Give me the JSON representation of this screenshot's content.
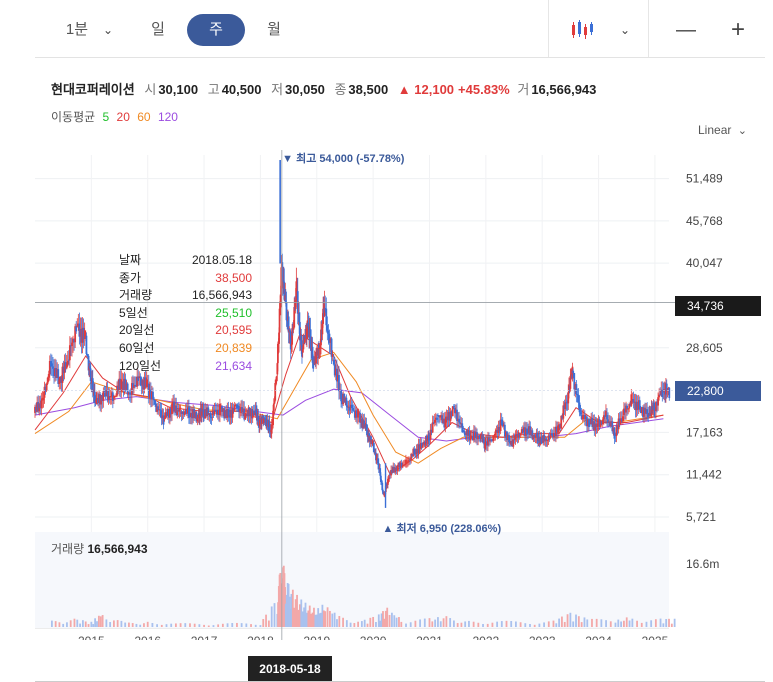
{
  "toolbar": {
    "periods": [
      "1분",
      "일",
      "주",
      "월"
    ],
    "active_period": "주",
    "chart_type_icon": "candle-chart-icon",
    "zoom_out": "—",
    "zoom_in": "+"
  },
  "stock": {
    "name": "현대코퍼레이션",
    "open_label": "시",
    "open": "30,100",
    "high_label": "고",
    "high": "40,500",
    "low_label": "저",
    "low": "30,050",
    "close_label": "종",
    "close": "38,500",
    "change": "▲ 12,100",
    "change_pct": "+45.83%",
    "volume_label": "거",
    "volume": "16,566,943"
  },
  "ma_legend": {
    "label": "이동평균",
    "periods": [
      "5",
      "20",
      "60",
      "120"
    ]
  },
  "scale": "Linear",
  "tooltip": {
    "rows": [
      {
        "k": "날짜",
        "v": "2018.05.18"
      },
      {
        "k": "종가",
        "v": "38,500"
      },
      {
        "k": "거래량",
        "v": "16,566,943"
      },
      {
        "k": "5일선",
        "v": "25,510"
      },
      {
        "k": "20일선",
        "v": "20,595"
      },
      {
        "k": "60일선",
        "v": "20,839"
      },
      {
        "k": "120일선",
        "v": "21,634"
      }
    ]
  },
  "volume_panel": {
    "label": "거래량",
    "value": "16,566,943",
    "tick": "16.6m"
  },
  "crosshair_date": "2018-05-18",
  "price_tags": {
    "crosshair": "34,736",
    "last": "22,800"
  },
  "chart_data": {
    "type": "line",
    "subtype": "candlestick",
    "x_ticks": [
      "2015",
      "2016",
      "2017",
      "2018",
      "2019",
      "2020",
      "2021",
      "2022",
      "2023",
      "2024",
      "2025"
    ],
    "y_ticks": [
      "51,489",
      "45,768",
      "40,047",
      "28,605",
      "17,163",
      "11,442",
      "5,721"
    ],
    "ylim": [
      5721,
      54000
    ],
    "xlim": [
      2014.0,
      2025.25
    ],
    "annotations": {
      "high": "▼ 최고 54,000 (-57.78%)",
      "low": "▲ 최저 6,950 (228.06%)"
    },
    "high_point": {
      "x": 2018.35,
      "y": 54000
    },
    "low_point": {
      "x": 2020.22,
      "y": 6950
    },
    "crosshair_x": 2018.38,
    "crosshair_y": 34736,
    "last_value": 22800,
    "colors": {
      "up": "#e03b3b",
      "down": "#3b6fd6",
      "ma5": "#1fbf2a",
      "ma20": "#e03b3b",
      "ma60": "#f08a24",
      "ma120": "#9b4ce0",
      "accent": "#3b5a9a"
    },
    "close": [
      [
        2014.0,
        19800
      ],
      [
        2014.15,
        21500
      ],
      [
        2014.3,
        26500
      ],
      [
        2014.45,
        24000
      ],
      [
        2014.6,
        27000
      ],
      [
        2014.75,
        31500
      ],
      [
        2014.9,
        30000
      ],
      [
        2015.0,
        24500
      ],
      [
        2015.1,
        21000
      ],
      [
        2015.25,
        22500
      ],
      [
        2015.4,
        21800
      ],
      [
        2015.55,
        24000
      ],
      [
        2015.7,
        22500
      ],
      [
        2015.85,
        24500
      ],
      [
        2016.0,
        23500
      ],
      [
        2016.15,
        21000
      ],
      [
        2016.3,
        19000
      ],
      [
        2016.45,
        20500
      ],
      [
        2016.6,
        20000
      ],
      [
        2016.75,
        19800
      ],
      [
        2016.9,
        19200
      ],
      [
        2017.0,
        20000
      ],
      [
        2017.15,
        19500
      ],
      [
        2017.3,
        20300
      ],
      [
        2017.45,
        19500
      ],
      [
        2017.6,
        20800
      ],
      [
        2017.75,
        19500
      ],
      [
        2017.9,
        20000
      ],
      [
        2018.0,
        18500
      ],
      [
        2018.1,
        19000
      ],
      [
        2018.2,
        17000
      ],
      [
        2018.3,
        25000
      ],
      [
        2018.38,
        38500
      ],
      [
        2018.45,
        35000
      ],
      [
        2018.55,
        29000
      ],
      [
        2018.65,
        36000
      ],
      [
        2018.75,
        28000
      ],
      [
        2018.85,
        32000
      ],
      [
        2018.95,
        26500
      ],
      [
        2019.05,
        28500
      ],
      [
        2019.15,
        34000
      ],
      [
        2019.3,
        27000
      ],
      [
        2019.45,
        22000
      ],
      [
        2019.6,
        20500
      ],
      [
        2019.75,
        19500
      ],
      [
        2019.9,
        17500
      ],
      [
        2020.0,
        15500
      ],
      [
        2020.1,
        13000
      ],
      [
        2020.2,
        8500
      ],
      [
        2020.3,
        11500
      ],
      [
        2020.45,
        12500
      ],
      [
        2020.6,
        13000
      ],
      [
        2020.75,
        14500
      ],
      [
        2020.9,
        15500
      ],
      [
        2021.0,
        16500
      ],
      [
        2021.15,
        19500
      ],
      [
        2021.3,
        18500
      ],
      [
        2021.45,
        20500
      ],
      [
        2021.6,
        17500
      ],
      [
        2021.75,
        16500
      ],
      [
        2021.9,
        16800
      ],
      [
        2022.0,
        15500
      ],
      [
        2022.15,
        16500
      ],
      [
        2022.3,
        18500
      ],
      [
        2022.45,
        15500
      ],
      [
        2022.6,
        17000
      ],
      [
        2022.75,
        17500
      ],
      [
        2022.9,
        16500
      ],
      [
        2023.0,
        16000
      ],
      [
        2023.15,
        16500
      ],
      [
        2023.3,
        17500
      ],
      [
        2023.45,
        21500
      ],
      [
        2023.55,
        25500
      ],
      [
        2023.7,
        19500
      ],
      [
        2023.85,
        18500
      ],
      [
        2024.0,
        18000
      ],
      [
        2024.15,
        19500
      ],
      [
        2024.3,
        17000
      ],
      [
        2024.45,
        19500
      ],
      [
        2024.6,
        21500
      ],
      [
        2024.75,
        20500
      ],
      [
        2024.9,
        19500
      ],
      [
        2025.0,
        20500
      ],
      [
        2025.15,
        22800
      ]
    ],
    "ma20": [
      [
        2014.0,
        17500
      ],
      [
        2014.5,
        22500
      ],
      [
        2014.9,
        27500
      ],
      [
        2015.2,
        24500
      ],
      [
        2015.6,
        22500
      ],
      [
        2016.0,
        22000
      ],
      [
        2016.4,
        20500
      ],
      [
        2017.0,
        20000
      ],
      [
        2017.6,
        20000
      ],
      [
        2018.2,
        18500
      ],
      [
        2018.45,
        25000
      ],
      [
        2018.7,
        30500
      ],
      [
        2019.0,
        29000
      ],
      [
        2019.3,
        27500
      ],
      [
        2019.6,
        22000
      ],
      [
        2020.0,
        16500
      ],
      [
        2020.3,
        11500
      ],
      [
        2020.7,
        13500
      ],
      [
        2021.0,
        15500
      ],
      [
        2021.4,
        18500
      ],
      [
        2021.8,
        17000
      ],
      [
        2022.3,
        16500
      ],
      [
        2022.8,
        17000
      ],
      [
        2023.3,
        17000
      ],
      [
        2023.6,
        20500
      ],
      [
        2024.0,
        18500
      ],
      [
        2024.5,
        18500
      ],
      [
        2025.15,
        19500
      ]
    ],
    "ma60": [
      [
        2014.0,
        17000
      ],
      [
        2014.6,
        20000
      ],
      [
        2015.0,
        24000
      ],
      [
        2015.6,
        22500
      ],
      [
        2016.2,
        21500
      ],
      [
        2017.0,
        20200
      ],
      [
        2017.8,
        20000
      ],
      [
        2018.3,
        19000
      ],
      [
        2018.6,
        23000
      ],
      [
        2018.9,
        27000
      ],
      [
        2019.3,
        28000
      ],
      [
        2019.7,
        24000
      ],
      [
        2020.0,
        19500
      ],
      [
        2020.4,
        14500
      ],
      [
        2020.8,
        13000
      ],
      [
        2021.2,
        15000
      ],
      [
        2021.6,
        16500
      ],
      [
        2022.2,
        16500
      ],
      [
        2022.8,
        16500
      ],
      [
        2023.4,
        16500
      ],
      [
        2023.8,
        19000
      ],
      [
        2024.3,
        18500
      ],
      [
        2025.15,
        19500
      ]
    ],
    "ma120": [
      [
        2014.0,
        19500
      ],
      [
        2014.7,
        20500
      ],
      [
        2015.2,
        21500
      ],
      [
        2015.8,
        22000
      ],
      [
        2016.5,
        21200
      ],
      [
        2017.2,
        20800
      ],
      [
        2017.9,
        20000
      ],
      [
        2018.4,
        19500
      ],
      [
        2018.8,
        21500
      ],
      [
        2019.3,
        23000
      ],
      [
        2019.8,
        22500
      ],
      [
        2020.3,
        19500
      ],
      [
        2020.8,
        16500
      ],
      [
        2021.3,
        16000
      ],
      [
        2021.8,
        16500
      ],
      [
        2022.4,
        16500
      ],
      [
        2023.0,
        16500
      ],
      [
        2023.6,
        17000
      ],
      [
        2024.2,
        18000
      ],
      [
        2025.15,
        19000
      ]
    ],
    "volume_max": 16566943,
    "volume": [
      [
        2014.3,
        1500000
      ],
      [
        2014.7,
        2000000
      ],
      [
        2015.0,
        1200000
      ],
      [
        2015.2,
        3500000
      ],
      [
        2015.6,
        1000000
      ],
      [
        2016.0,
        1400000
      ],
      [
        2016.5,
        900000
      ],
      [
        2017.0,
        800000
      ],
      [
        2017.5,
        900000
      ],
      [
        2018.0,
        1000000
      ],
      [
        2018.3,
        7000000
      ],
      [
        2018.38,
        16566943
      ],
      [
        2018.45,
        11000000
      ],
      [
        2018.55,
        9000000
      ],
      [
        2018.7,
        6500000
      ],
      [
        2018.85,
        5000000
      ],
      [
        2019.0,
        4000000
      ],
      [
        2019.15,
        5500000
      ],
      [
        2019.4,
        2500000
      ],
      [
        2019.8,
        1500000
      ],
      [
        2020.1,
        3000000
      ],
      [
        2020.25,
        4500000
      ],
      [
        2020.5,
        2000000
      ],
      [
        2021.0,
        2000000
      ],
      [
        2021.3,
        2500000
      ],
      [
        2021.7,
        1500000
      ],
      [
        2022.2,
        1500000
      ],
      [
        2022.7,
        1200000
      ],
      [
        2023.2,
        1500000
      ],
      [
        2023.5,
        3500000
      ],
      [
        2023.8,
        2000000
      ],
      [
        2024.3,
        1500000
      ],
      [
        2024.6,
        2500000
      ],
      [
        2025.1,
        2000000
      ]
    ]
  }
}
